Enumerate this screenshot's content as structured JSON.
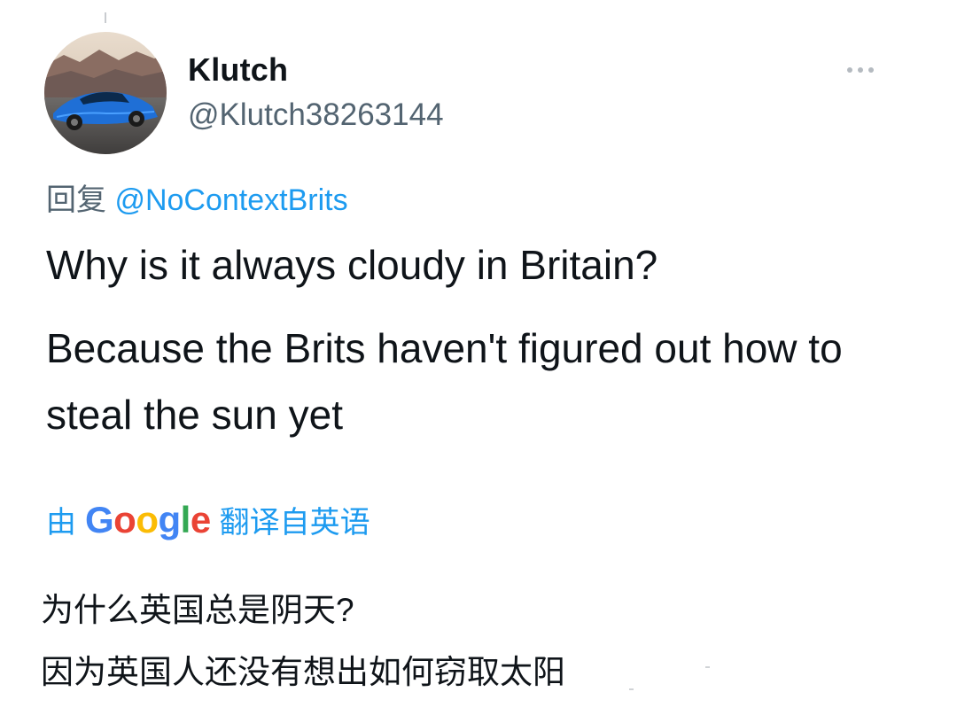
{
  "tweet": {
    "display_name": "Klutch",
    "handle": "@Klutch38263144",
    "reply_prefix": "回复",
    "reply_mention": "@NoContextBrits",
    "body_line_1": "Why is it always cloudy in Britain?",
    "body_line_2": "Because the Brits haven't figured out how to steal the sun yet",
    "translation": {
      "prefix": "由",
      "provider_letters": [
        "G",
        "o",
        "o",
        "g",
        "l",
        "e"
      ],
      "suffix": "翻译自英语",
      "line_1": "为什么英国总是阴天?",
      "line_2": "因为英国人还没有想出如何窃取太阳"
    }
  },
  "icons": {
    "more": "more-horizontal-icon",
    "avatar": "avatar-blue-sports-car"
  },
  "colors": {
    "link": "#1d9bf0",
    "secondary_text": "#536471",
    "primary_text": "#0f1419",
    "google_blue": "#4285f4",
    "google_red": "#ea4335",
    "google_yellow": "#fbbc05",
    "google_green": "#34a853"
  }
}
